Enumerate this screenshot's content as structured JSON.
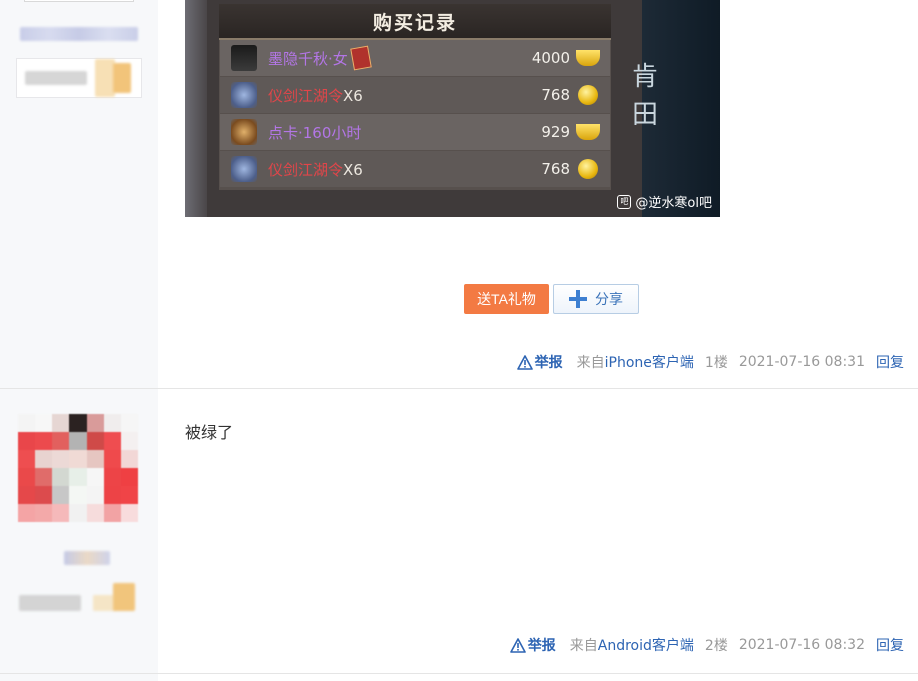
{
  "purchase_panel": {
    "title": "购买记录",
    "items": [
      {
        "name_part1": "墨隐千秋·女",
        "name_part2": "",
        "price": "4000",
        "currency": "ingot-icon"
      },
      {
        "name_part1": "仪剑江湖令",
        "name_part2": "X6",
        "price": "768",
        "currency": "coin-icon"
      },
      {
        "name_part1": "点卡·160小时",
        "name_part2": "",
        "price": "929",
        "currency": "ingot-icon"
      },
      {
        "name_part1": "仪剑江湖令",
        "name_part2": "X6",
        "price": "768",
        "currency": "coin-icon"
      }
    ],
    "watermark": "@逆水寒ol吧",
    "side_glyphs": [
      "肯",
      "田"
    ]
  },
  "actions": {
    "gift_label": "送TA礼物",
    "share_label": "分享"
  },
  "post1": {
    "report": "举报",
    "source_prefix": "来自",
    "source_client": "iPhone客户端",
    "floor": "1楼",
    "time": "2021-07-16 08:31",
    "reply": "回复"
  },
  "post2": {
    "text": "被绿了",
    "report": "举报",
    "source_prefix": "来自",
    "source_client": "Android客户端",
    "floor": "2楼",
    "time": "2021-07-16 08:32",
    "reply": "回复"
  },
  "colors": {
    "link": "#2d64b3",
    "gift_button": "#f37a43",
    "meta_text": "#999999",
    "sidebar_bg": "#f7f8fa"
  }
}
